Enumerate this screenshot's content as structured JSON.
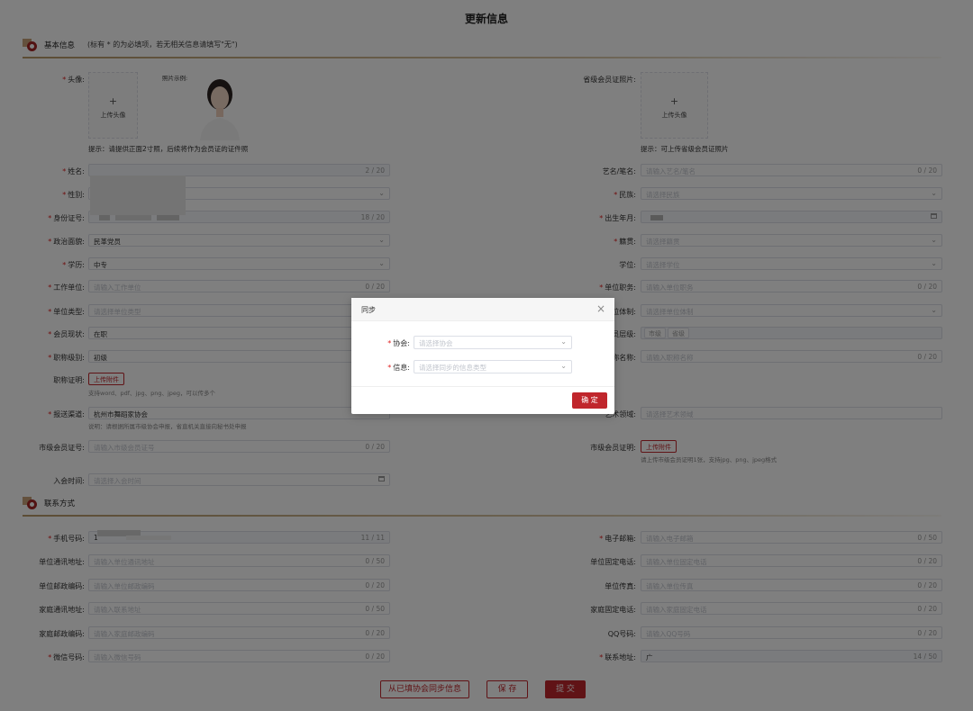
{
  "title": "更新信息",
  "sections": {
    "basic": {
      "title": "基本信息",
      "note": "(标有 * 的为必填项，若无相关信息请填写\"无\")"
    },
    "contact": {
      "title": "联系方式"
    }
  },
  "basic": {
    "avatar": {
      "label": "头像:",
      "upload_plus": "+",
      "upload_text": "上传头像",
      "sample_label": "照片示例:",
      "hint": "提示：请提供正面2寸照，后续将作为会员证的证件照"
    },
    "province_photo": {
      "label": "省级会员证照片:",
      "upload_plus": "+",
      "upload_text": "上传头像",
      "hint": "提示：可上传省级会员证照片"
    },
    "name": {
      "label": "姓名:",
      "count": "2 / 20"
    },
    "stage_name": {
      "label": "艺名/笔名:",
      "placeholder": "请输入艺名/笔名",
      "count": "0 / 20"
    },
    "gender": {
      "label": "性别:"
    },
    "ethnicity": {
      "label": "民族:",
      "placeholder": "请选择民族"
    },
    "id_number": {
      "label": "身份证号:",
      "count": "18 / 20"
    },
    "birth": {
      "label": "出生年月:"
    },
    "politics": {
      "label": "政治面貌:",
      "value": "民革党员"
    },
    "native": {
      "label": "籍贯:",
      "placeholder": "请选择籍贯"
    },
    "education": {
      "label": "学历:",
      "value": "中专"
    },
    "degree": {
      "label": "学位:",
      "placeholder": "请选择学位"
    },
    "work_unit": {
      "label": "工作单位:",
      "placeholder": "请输入工作单位",
      "count": "0 / 20"
    },
    "unit_position": {
      "label": "单位职务:",
      "placeholder": "请输入单位职务",
      "count": "0 / 20"
    },
    "unit_type": {
      "label": "单位类型:",
      "placeholder": "请选择单位类型"
    },
    "unit_system": {
      "label": "位体制:",
      "placeholder": "请选择单位体制"
    },
    "member_status": {
      "label": "会员现状:",
      "value": "在职"
    },
    "member_level": {
      "label": "员层级:",
      "tags": [
        "市级",
        "省级"
      ]
    },
    "title_level": {
      "label": "职称级别:",
      "value": "初级"
    },
    "title_name": {
      "label": "称名称:",
      "placeholder": "请输入职称名称",
      "count": "0 / 20"
    },
    "title_cert": {
      "label": "职称证明:",
      "button": "上传附件",
      "hint": "支持word、pdf、jpg、png、jpeg，可以传多个"
    },
    "channel": {
      "label": "报送渠道:",
      "value": "杭州市舞蹈家协会",
      "hint": "说明：请根据所属市级协会申报，省直机关直接向秘书处申报"
    },
    "art_field": {
      "label": "艺术领域:",
      "placeholder": "请选择艺术领域"
    },
    "city_member_no": {
      "label": "市级会员证号:",
      "placeholder": "请输入市级会员证号",
      "count": "0 / 20"
    },
    "city_member_cert": {
      "label": "市级会员证明:",
      "button": "上传附件",
      "hint": "请上传市级会员证明1张，支持jpg、png、jpeg格式"
    },
    "join_date": {
      "label": "入会时间:",
      "placeholder": "请选择入会时间"
    }
  },
  "contact": {
    "phone": {
      "label": "手机号码:",
      "value": "1",
      "count": "11 / 11"
    },
    "email": {
      "label": "电子邮箱:",
      "placeholder": "请输入电子邮箱",
      "count": "0 / 50"
    },
    "unit_address": {
      "label": "单位通讯地址:",
      "placeholder": "请输入单位通讯地址",
      "count": "0 / 50"
    },
    "unit_phone": {
      "label": "单位固定电话:",
      "placeholder": "请输入单位固定电话",
      "count": "0 / 20"
    },
    "unit_zip": {
      "label": "单位邮政编码:",
      "placeholder": "请输入单位邮政编码",
      "count": "0 / 20"
    },
    "unit_fax": {
      "label": "单位传真:",
      "placeholder": "请输入单位传真",
      "count": "0 / 20"
    },
    "home_address": {
      "label": "家庭通讯地址:",
      "placeholder": "请输入联系地址",
      "count": "0 / 50"
    },
    "home_phone": {
      "label": "家庭固定电话:",
      "placeholder": "请输入家庭固定电话",
      "count": "0 / 20"
    },
    "home_zip": {
      "label": "家庭邮政编码:",
      "placeholder": "请输入家庭邮政编码",
      "count": "0 / 20"
    },
    "qq": {
      "label": "QQ号码:",
      "placeholder": "请输入QQ号码",
      "count": "0 / 20"
    },
    "wechat": {
      "label": "微信号码:",
      "placeholder": "请输入微信号码",
      "count": "0 / 20"
    },
    "contact_address": {
      "label": "联系地址:",
      "value": "广",
      "count": "14 / 50"
    }
  },
  "actions": {
    "sync": "从已填协会同步信息",
    "save": "保 存",
    "submit": "提 交"
  },
  "dialog": {
    "title": "同步",
    "close": "×",
    "association_label": "协会:",
    "association_placeholder": "请选择协会",
    "info_label": "信息:",
    "info_placeholder": "请选择同步的信息类型",
    "confirm": "确 定"
  },
  "colors": {
    "accent": "#c0262c",
    "required": "#e02020",
    "section_line": "#b89a6a"
  },
  "icons": {
    "section": "section-badge-icon",
    "chevron": "chevron-down-icon",
    "calendar": "calendar-icon",
    "close": "close-icon"
  }
}
